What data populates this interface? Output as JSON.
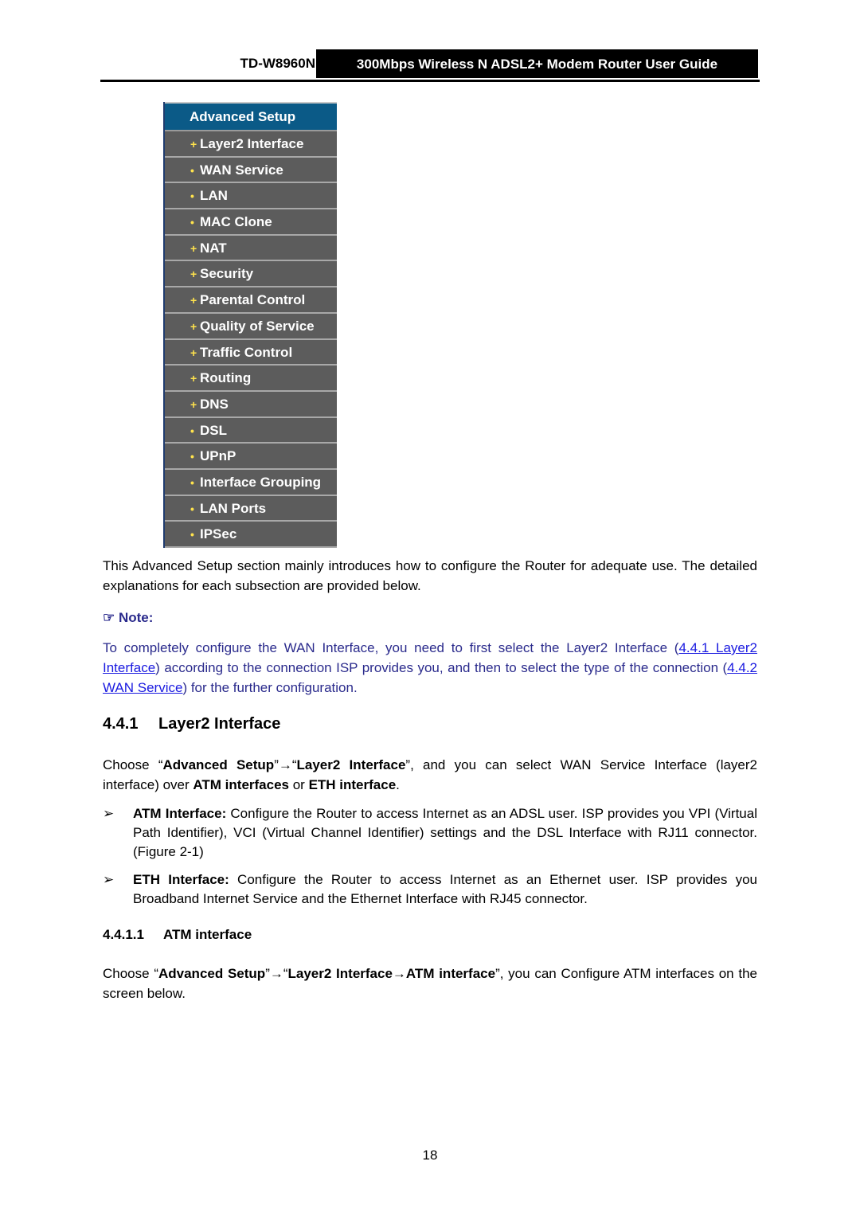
{
  "header": {
    "model": "TD-W8960N",
    "guide_title": "300Mbps Wireless N ADSL2+ Modem Router User Guide"
  },
  "menu": {
    "title": "Advanced Setup",
    "items": [
      {
        "bullet": "+",
        "label": "Layer2 Interface"
      },
      {
        "bullet": "•",
        "label": "WAN Service"
      },
      {
        "bullet": "•",
        "label": "LAN"
      },
      {
        "bullet": "•",
        "label": "MAC Clone"
      },
      {
        "bullet": "+",
        "label": "NAT"
      },
      {
        "bullet": "+",
        "label": "Security"
      },
      {
        "bullet": "+",
        "label": "Parental Control"
      },
      {
        "bullet": "+",
        "label": "Quality of Service"
      },
      {
        "bullet": "+",
        "label": "Traffic Control"
      },
      {
        "bullet": "+",
        "label": "Routing"
      },
      {
        "bullet": "+",
        "label": "DNS"
      },
      {
        "bullet": "•",
        "label": "DSL"
      },
      {
        "bullet": "•",
        "label": "UPnP"
      },
      {
        "bullet": "•",
        "label": "Interface Grouping"
      },
      {
        "bullet": "•",
        "label": "LAN Ports"
      },
      {
        "bullet": "•",
        "label": "IPSec"
      }
    ]
  },
  "intro": "This Advanced Setup section mainly introduces how to configure the Router for adequate use. The detailed explanations for each subsection are provided below.",
  "note": {
    "icon": "☞",
    "label": "Note:",
    "text_1": "To completely configure the WAN Interface, you need to first select the Layer2 Interface (",
    "link_1": "4.4.1 Layer2 Interface",
    "text_2": ") according to the connection ISP provides you, and then to select the type of the connection (",
    "link_2": "4.4.2 WAN Service",
    "text_3": ") for the further configuration."
  },
  "section": {
    "number": "4.4.1",
    "title": "Layer2 Interface",
    "p1": {
      "a": "Choose “",
      "b": "Advanced Setup",
      "c": "”→“",
      "d": "Layer2 Interface",
      "e": "”, and you can select WAN Service Interface (layer2 interface) over ",
      "f": "ATM interfaces",
      "g": " or ",
      "h": "ETH interface",
      "i": "."
    },
    "bullets": [
      {
        "mark": "➢",
        "bold": "ATM Interface:",
        "text": " Configure the Router to access Internet as an ADSL user. ISP provides you VPI (Virtual Path Identifier), VCI (Virtual Channel Identifier) settings and the DSL Interface with RJ11 connector. (Figure 2-1)"
      },
      {
        "mark": "➢",
        "bold": "ETH Interface:",
        "text": " Configure the Router to access Internet as an Ethernet user. ISP provides you Broadband Internet Service and the Ethernet Interface with RJ45 connector."
      }
    ]
  },
  "subsection": {
    "number": "4.4.1.1",
    "title": "ATM interface",
    "p": {
      "a": "Choose “",
      "b": "Advanced Setup",
      "c": "”→“",
      "d": "Layer2 Interface→ATM interface",
      "e": "”, you can Configure ATM interfaces on the screen below."
    }
  },
  "page_number": "18"
}
